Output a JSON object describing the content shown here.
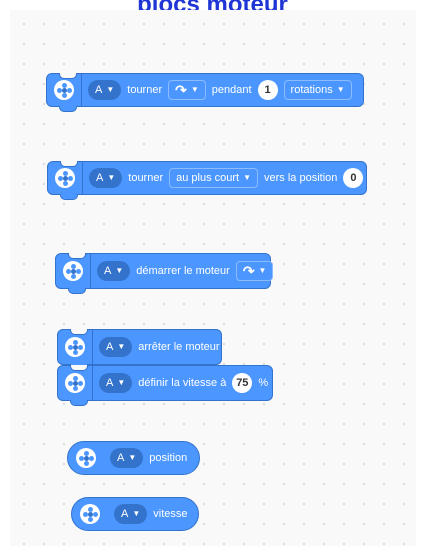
{
  "page": {
    "title": "blocs moteur"
  },
  "blocks": {
    "run_rotations": {
      "port": "A",
      "label_turn": "tourner",
      "direction_icon": "clockwise-arrow-icon",
      "label_for": "pendant",
      "amount": "1",
      "unit": "rotations"
    },
    "run_to_position": {
      "port": "A",
      "label_turn": "tourner",
      "mode": "au plus court",
      "label_to": "vers la position",
      "position": "0"
    },
    "start_motor": {
      "port": "A",
      "label": "démarrer le moteur",
      "direction_icon": "clockwise-arrow-icon"
    },
    "stop_motor": {
      "port": "A",
      "label": "arrêter le moteur"
    },
    "set_speed": {
      "port": "A",
      "label": "définir la vitesse à",
      "value": "75",
      "unit": "%"
    },
    "position_reporter": {
      "port": "A",
      "label": "position"
    },
    "speed_reporter": {
      "port": "A",
      "label": "vitesse"
    }
  },
  "colors": {
    "block": "#4c97ff",
    "block_border": "#3373cc",
    "title": "#1f35d6"
  }
}
